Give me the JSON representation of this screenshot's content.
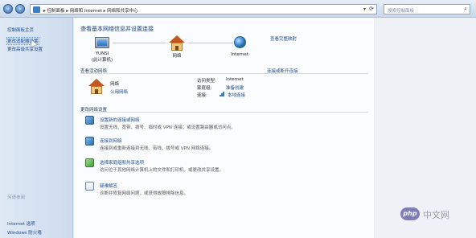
{
  "address_bar": {
    "crumbs": "▸ 控制面板 ▸ 网络和 Internet ▸ 网络和共享中心",
    "search_placeholder": "搜索控制面板"
  },
  "sidebar": {
    "items": [
      {
        "label": "控制面板主页"
      },
      {
        "label": "更改适配器设置"
      },
      {
        "label": "更改高级共享设置"
      }
    ],
    "see_also_title": "另请参阅",
    "see_also": [
      {
        "label": "Internet 选项"
      },
      {
        "label": "Windows 防火墙"
      }
    ]
  },
  "main": {
    "heading": "查看基本网络信息并设置连接",
    "full_map": "查看完整映射",
    "map": {
      "computer_name": "YUNSI",
      "computer_sub": "(此计算机)",
      "network": "网络",
      "internet": "Internet"
    },
    "active_networks": {
      "title": "查看活动网络",
      "connect_disconnect": "连接或断开连接",
      "network_name": "网络",
      "network_type": "公用网络",
      "access_type_label": "访问类型:",
      "access_type_value": "Internet",
      "homegroup_label": "家庭组:",
      "homegroup_value": "准备创建",
      "connections_label": "连接:",
      "connections_value": "本地连接"
    },
    "change_settings": {
      "title": "更改网络设置",
      "tasks": [
        {
          "title": "设置新的连接或网络",
          "desc": "设置无线、宽带、拨号、临时或 VPN 连接；或设置路由器或访问点。"
        },
        {
          "title": "连接到网络",
          "desc": "连接到或重新连接到无线、有线、拨号或 VPN 网络连接。"
        },
        {
          "title": "选择家庭组和共享选项",
          "desc": "访问位于其他网络计算机上的文件和打印机，或更改共享设置。"
        },
        {
          "title": "疑难解答",
          "desc": "诊断并修复网络问题，或获得故障排除信息。"
        }
      ]
    }
  },
  "watermark": {
    "logo": "php",
    "text": "中文网"
  }
}
